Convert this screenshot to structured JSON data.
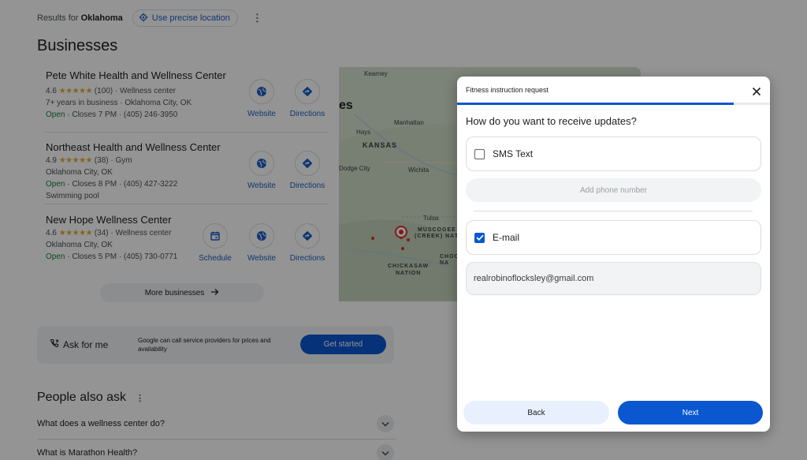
{
  "results_bar": {
    "prefix": "Results for",
    "location": "Oklahoma",
    "precise_label": "Use precise location"
  },
  "businesses_heading": "Businesses",
  "businesses": [
    {
      "name": "Pete White Health and Wellness Center",
      "rating": "4.6",
      "stars": "★★★★★",
      "reviews": "(100)",
      "category": "· Wellness center",
      "line2": "7+ years in business · Oklahoma City, OK",
      "open": "Open",
      "hours": "· Closes 7 PM · (405) 246-3950",
      "line4": "",
      "actions": [
        "Website",
        "Directions"
      ]
    },
    {
      "name": "Northeast Health and Wellness Center",
      "rating": "4.9",
      "stars": "★★★★★",
      "reviews": "(38)",
      "category": "· Gym",
      "line2": "Oklahoma City, OK",
      "open": "Open",
      "hours": "· Closes 8 PM · (405) 427-3222",
      "line4": "Swimming pool",
      "actions": [
        "Website",
        "Directions"
      ]
    },
    {
      "name": "New Hope Wellness Center",
      "rating": "4.6",
      "stars": "★★★★★",
      "reviews": "(34)",
      "category": "· Wellness center",
      "line2": "Oklahoma City, OK",
      "open": "Open",
      "hours": "· Closes 5 PM · (405) 730-0771",
      "line4": "",
      "actions": [
        "Schedule",
        "Website",
        "Directions"
      ]
    }
  ],
  "more_businesses": "More businesses",
  "map": {
    "labels": [
      "Kearney",
      "es",
      "Hays",
      "KANSAS",
      "Manhattan",
      "Dodge City",
      "Wichita",
      "Tulsa",
      "MUSCOGEE",
      "(CREEK) NATI",
      "CHICKASAW",
      "NATION",
      "CHOC",
      "NA"
    ]
  },
  "ask": {
    "title": "Ask for me",
    "description": "Google can call service providers for prices and availability",
    "button": "Get started"
  },
  "paa": {
    "heading": "People also ask",
    "questions": [
      "What does a wellness center do?",
      "What is Marathon Health?"
    ]
  },
  "dialog": {
    "title": "Fitness instruction request",
    "progress": 0.885,
    "question": "How do you want to receive updates?",
    "sms_label": "SMS Text",
    "sms_checked": false,
    "phone_placeholder": "Add phone number",
    "email_label": "E-mail",
    "email_checked": true,
    "email_value": "realrobinoflocksley@gmail.com",
    "back_label": "Back",
    "next_label": "Next"
  },
  "colors": {
    "accent": "#0b57d0",
    "link": "#1a5ec4",
    "open": "#188038",
    "star": "#e7a93b"
  }
}
